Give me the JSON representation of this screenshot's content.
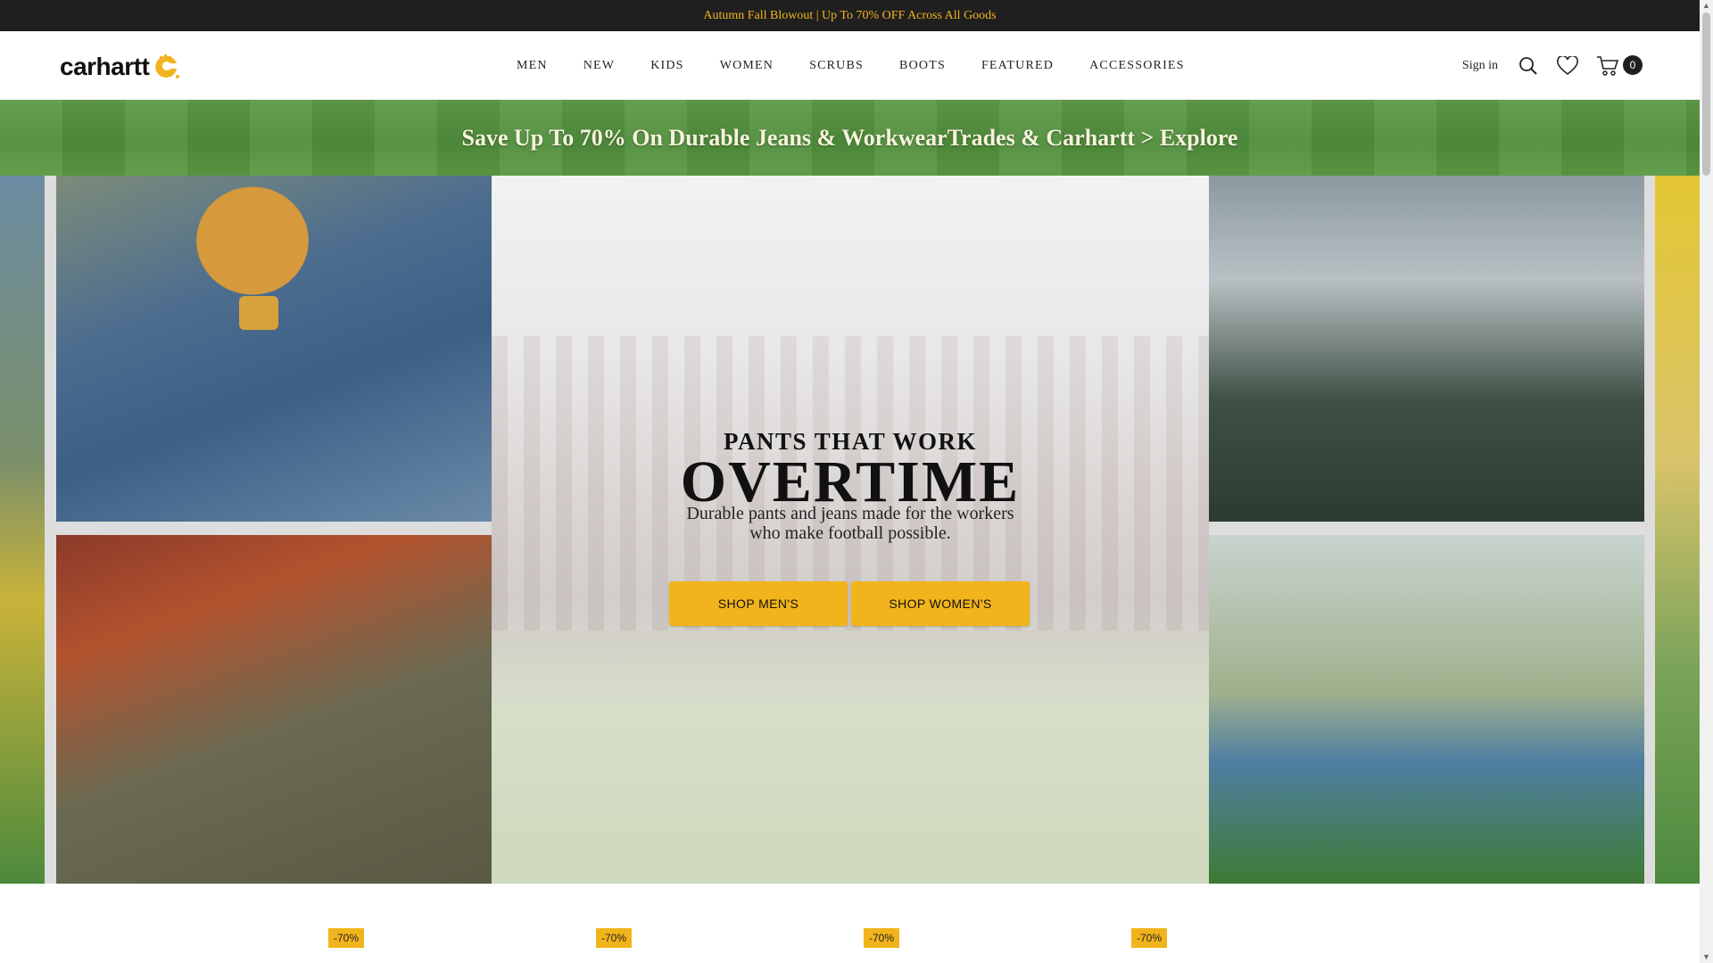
{
  "announcement": {
    "text": "Autumn Fall Blowout | Up To 70% OFF Across All Goods"
  },
  "brand": {
    "logo_text": "carhartt",
    "logo_icon": "carhartt-c-logo-icon",
    "accent": "#f2b41c"
  },
  "nav": {
    "items": [
      {
        "label": "MEN"
      },
      {
        "label": "NEW"
      },
      {
        "label": "KIDS"
      },
      {
        "label": "WOMEN"
      },
      {
        "label": "SCRUBS"
      },
      {
        "label": "BOOTS"
      },
      {
        "label": "FEATURED"
      },
      {
        "label": "ACCESSORIES"
      }
    ]
  },
  "header_actions": {
    "sign_in": "Sign in",
    "search_icon": "search-icon",
    "wishlist_icon": "heart-icon",
    "cart_icon": "cart-icon",
    "cart_count": "0"
  },
  "promo_banner": {
    "text": "Save Up To 70% On Durable Jeans & WorkwearTrades & Carhartt > Explore"
  },
  "hero": {
    "kicker": "PANTS THAT WORK",
    "headline": "OVERTIME",
    "subcopy": "Durable pants and jeans made for the workers who make football possible.",
    "buttons": [
      {
        "label": "SHOP MEN'S"
      },
      {
        "label": "SHOP WOMEN'S"
      }
    ]
  },
  "products": {
    "badges": [
      {
        "label": "-70%"
      },
      {
        "label": "-70%"
      },
      {
        "label": "-70%"
      },
      {
        "label": "-70%"
      }
    ]
  }
}
